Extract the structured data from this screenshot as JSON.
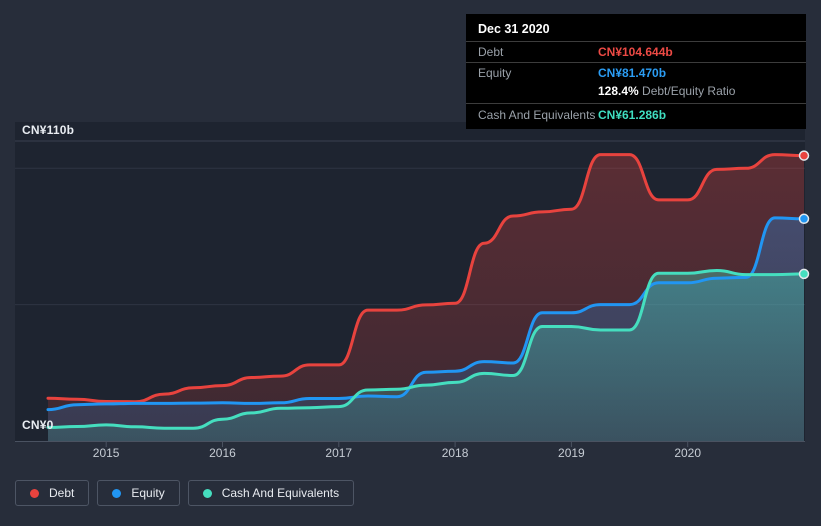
{
  "colors": {
    "debt": "#e8433e",
    "equity": "#2196f3",
    "cash": "#45debf",
    "debt_value_text": "#ed4a45",
    "equity_value_text": "#2b9df4",
    "cash_value_text": "#3fdec0",
    "page_bg": "#272d3a",
    "plot_bg": "#1e2430",
    "grid": "#2e3542",
    "grid_top": "#3a4150",
    "axis": "#4a5261",
    "tick_label": "#c6ccd4",
    "tooltip_bg": "#000000"
  },
  "tooltip": {
    "title": "Dec 31 2020",
    "debt_label": "Debt",
    "debt_value": "CN¥104.644b",
    "equity_label": "Equity",
    "equity_value": "CN¥81.470b",
    "ratio_value": "128.4%",
    "ratio_label": "Debt/Equity Ratio",
    "cash_label": "Cash And Equivalents",
    "cash_value": "CN¥61.286b"
  },
  "axis": {
    "y_max_label": "CN¥110b",
    "y_zero_label": "CN¥0"
  },
  "legend": [
    {
      "label": "Debt",
      "color": "#e8433e"
    },
    {
      "label": "Equity",
      "color": "#2196f3"
    },
    {
      "label": "Cash And Equivalents",
      "color": "#45debf"
    }
  ],
  "chart_data": {
    "type": "area",
    "title": "Debt, Equity and Cash history (CN¥ billions)",
    "currency_unit": "CN¥ billions",
    "x": [
      "2014-06",
      "2014-09",
      "2014-12",
      "2015-03",
      "2015-06",
      "2015-09",
      "2015-12",
      "2016-03",
      "2016-06",
      "2016-09",
      "2016-12",
      "2017-03",
      "2017-06",
      "2017-09",
      "2017-12",
      "2018-03",
      "2018-06",
      "2018-09",
      "2018-12",
      "2019-03",
      "2019-06",
      "2019-09",
      "2019-12",
      "2020-03",
      "2020-06",
      "2020-09",
      "2020-12"
    ],
    "series": [
      {
        "name": "Debt",
        "color": "#e8433e",
        "values": [
          15.7,
          15.3,
          14.5,
          14.4,
          17.2,
          19.5,
          20.3,
          23.3,
          23.8,
          27.9,
          27.9,
          48.0,
          48.0,
          49.9,
          50.5,
          72.5,
          82.5,
          84.0,
          85.0,
          105.0,
          105.0,
          88.4,
          88.4,
          99.6,
          100.0,
          105.0,
          104.644
        ]
      },
      {
        "name": "Equity",
        "color": "#2196f3",
        "values": [
          11.5,
          13.3,
          13.6,
          13.8,
          13.8,
          13.9,
          14.0,
          13.8,
          14.0,
          15.6,
          15.6,
          16.5,
          16.2,
          25.2,
          25.6,
          29.1,
          28.6,
          47.0,
          47.0,
          50.0,
          50.0,
          58.0,
          58.0,
          59.7,
          60.0,
          81.8,
          81.47
        ]
      },
      {
        "name": "Cash And Equivalents",
        "color": "#45debf",
        "values": [
          5.0,
          5.3,
          5.9,
          5.2,
          4.7,
          4.7,
          8.0,
          10.3,
          12.0,
          12.2,
          12.6,
          18.7,
          19.0,
          20.5,
          21.5,
          24.8,
          24.0,
          42.0,
          42.0,
          40.7,
          40.7,
          61.5,
          61.5,
          62.5,
          61.0,
          61.0,
          61.286
        ]
      }
    ],
    "ylim": [
      0,
      110
    ],
    "y_gridline_values": [
      110,
      100,
      50
    ],
    "y_axis_labels": [
      "CN¥0",
      "CN¥110b"
    ],
    "x_tick_labels": [
      "2015",
      "2016",
      "2017",
      "2018",
      "2019",
      "2020"
    ],
    "x_tick_indices": [
      2,
      6,
      10,
      14,
      18,
      22
    ],
    "grid": "horizontal",
    "legend_position": "bottom-left",
    "tooltip_point": {
      "date": "Dec 31 2020",
      "debt": 104.644,
      "equity": 81.47,
      "cash": 61.286,
      "debt_equity_ratio_pct": 128.4
    }
  }
}
